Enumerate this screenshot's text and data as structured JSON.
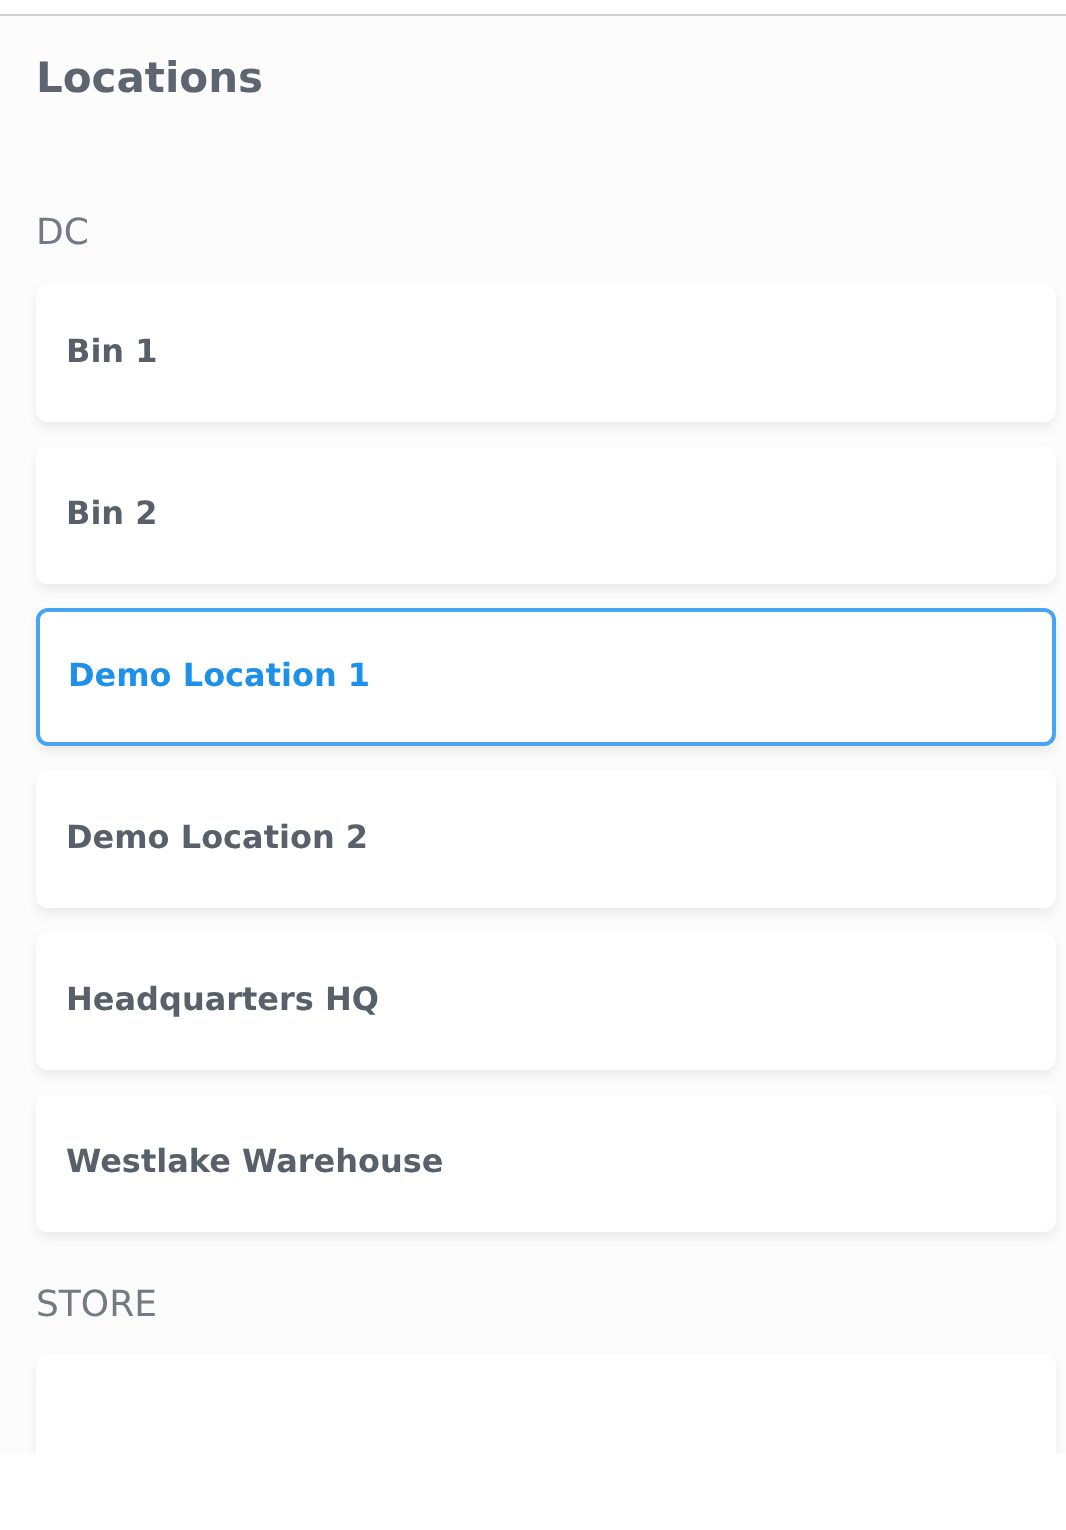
{
  "title": "Locations",
  "groups": [
    {
      "heading": "DC",
      "items": [
        {
          "label": "Bin 1",
          "selected": false
        },
        {
          "label": "Bin 2",
          "selected": false
        },
        {
          "label": "Demo Location 1",
          "selected": true
        },
        {
          "label": "Demo Location 2",
          "selected": false
        },
        {
          "label": "Headquarters HQ",
          "selected": false
        },
        {
          "label": "Westlake Warehouse",
          "selected": false
        }
      ]
    },
    {
      "heading": "STORE",
      "items": [
        {
          "selected": false
        }
      ]
    }
  ]
}
